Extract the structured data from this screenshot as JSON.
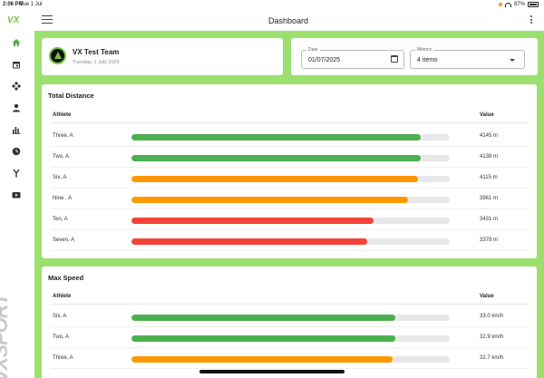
{
  "status_bar": {
    "time": "2:06 PM",
    "date": "Tue 1 Jul",
    "battery": "87%"
  },
  "sidebar": {
    "logo": "VX",
    "brand": "VXSPORT",
    "items": [
      {
        "icon": "home-icon",
        "active": true
      },
      {
        "icon": "calendar-icon"
      },
      {
        "icon": "drills-icon"
      },
      {
        "icon": "person-icon"
      },
      {
        "icon": "bar-chart-icon"
      },
      {
        "icon": "clock-icon"
      },
      {
        "icon": "merge-icon"
      },
      {
        "icon": "video-icon"
      }
    ]
  },
  "header": {
    "title": "Dashboard"
  },
  "team": {
    "name": "VX Test Team",
    "date": "Tuesday, 1 July 2025"
  },
  "filters": {
    "date_label": "Date",
    "date_value": "01/07/2025",
    "metrics_label": "Metrics",
    "metrics_value": "4 items"
  },
  "colors": {
    "accent": "#9be06f",
    "good": "#4caf50",
    "mid": "#ff9800",
    "low": "#f44336"
  },
  "metric_cards": [
    {
      "title": "Total Distance",
      "col_athlete": "Athlete",
      "col_value": "Value",
      "rows": [
        {
          "athlete": "Three, A",
          "value": "4145 m",
          "fraction": 0.91,
          "color": "#4caf50"
        },
        {
          "athlete": "Two, A",
          "value": "4138 m",
          "fraction": 0.91,
          "color": "#4caf50"
        },
        {
          "athlete": "Six, A",
          "value": "4115 m",
          "fraction": 0.9,
          "color": "#ff9800"
        },
        {
          "athlete": "Nine , A",
          "value": "3961 m",
          "fraction": 0.87,
          "color": "#ff9800"
        },
        {
          "athlete": "Ten, A",
          "value": "3431 m",
          "fraction": 0.76,
          "color": "#f44336"
        },
        {
          "athlete": "Seven, A",
          "value": "3378 m",
          "fraction": 0.74,
          "color": "#f44336"
        }
      ]
    },
    {
      "title": "Max Speed",
      "col_athlete": "Athlete",
      "col_value": "Value",
      "rows": [
        {
          "athlete": "Six, A",
          "value": "33.0 km/h",
          "fraction": 0.83,
          "color": "#4caf50"
        },
        {
          "athlete": "Two, A",
          "value": "32.9 km/h",
          "fraction": 0.83,
          "color": "#4caf50"
        },
        {
          "athlete": "Three, A",
          "value": "32.7 km/h",
          "fraction": 0.82,
          "color": "#ff9800"
        }
      ]
    }
  ]
}
